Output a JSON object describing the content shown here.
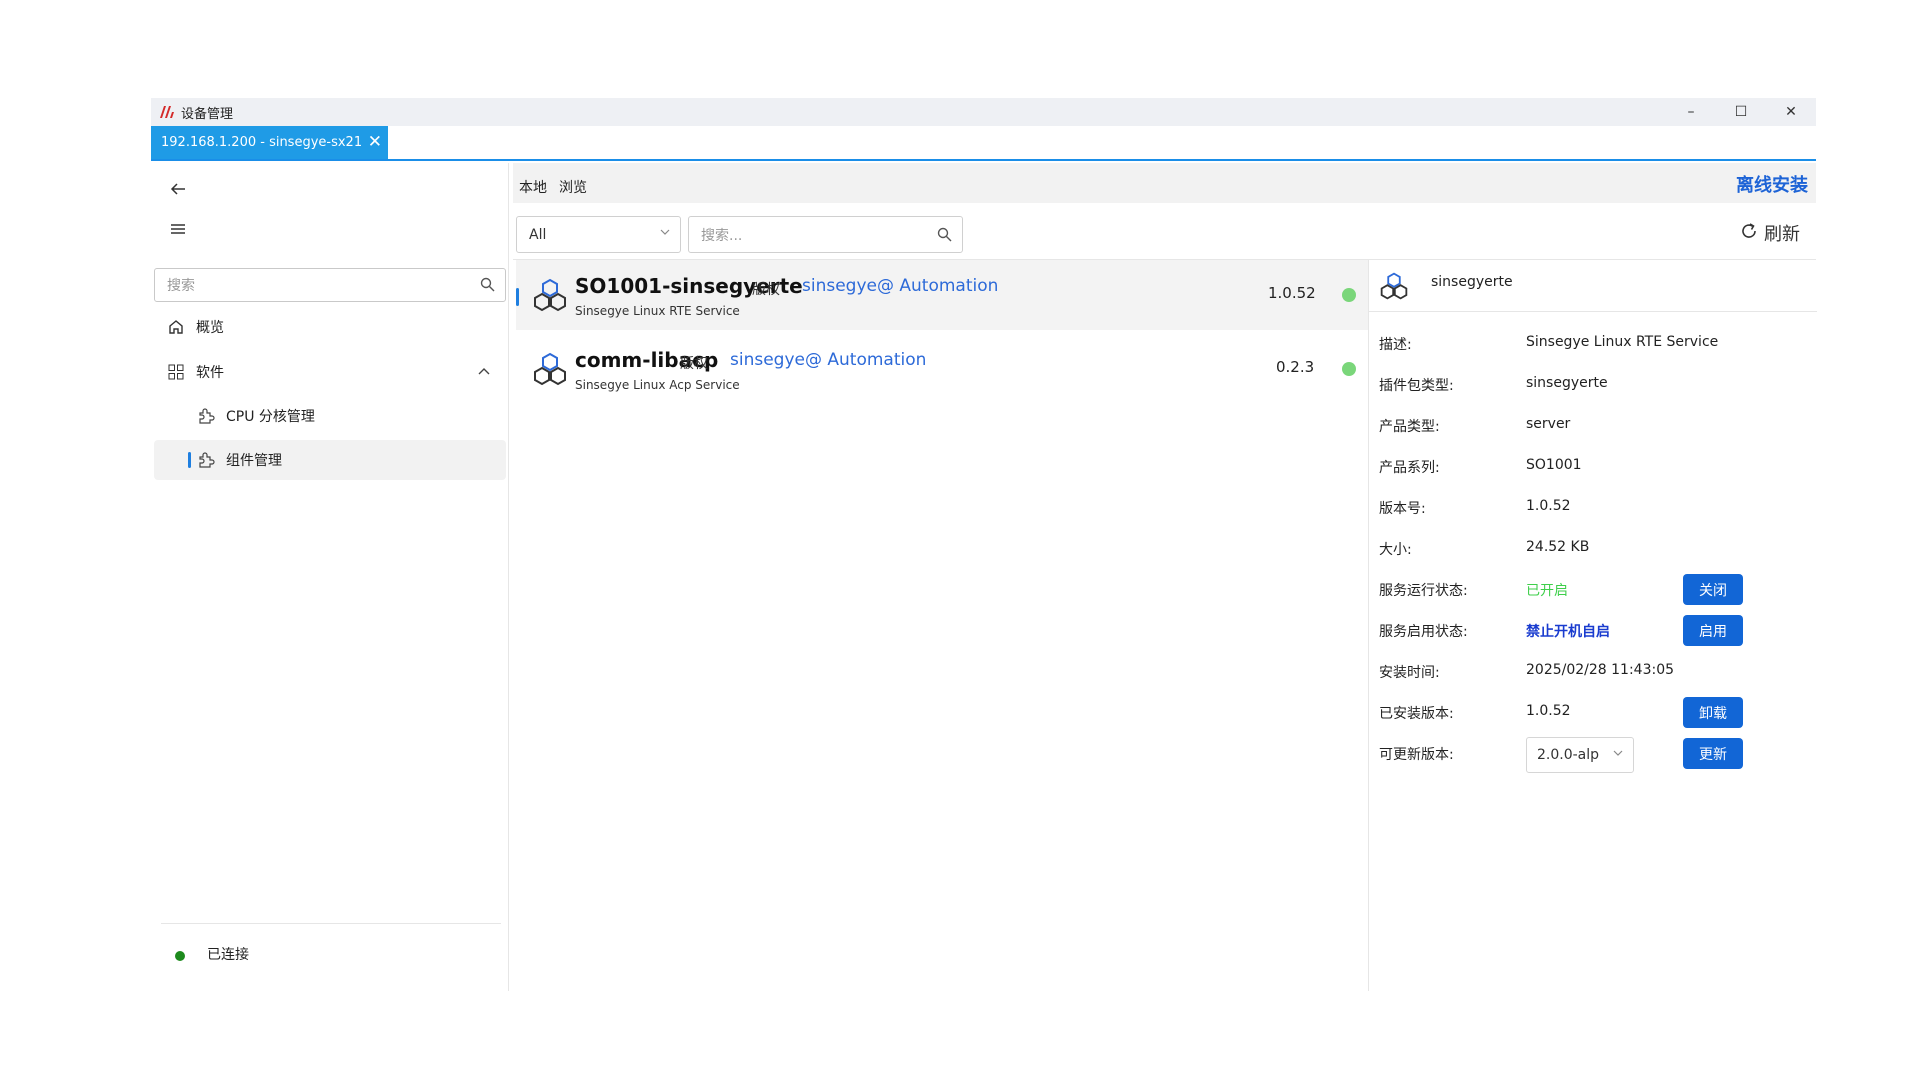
{
  "window": {
    "title": "设备管理",
    "min_label": "–",
    "max_label": "☐",
    "close_label": "✕"
  },
  "connection_tab": {
    "label": "192.168.1.200 - sinsegye-sx21",
    "close_label": "✕"
  },
  "sidebar": {
    "search_placeholder": "搜索",
    "items": [
      {
        "label": "概览",
        "icon": "home-icon"
      },
      {
        "label": "软件",
        "icon": "apps-grid-icon"
      },
      {
        "label": "CPU 分核管理",
        "icon": "puzzle-icon"
      },
      {
        "label": "组件管理",
        "icon": "puzzle-icon"
      }
    ],
    "status": "已连接"
  },
  "main": {
    "tabs": [
      "本地",
      "浏览"
    ],
    "offline_install": "离线安装",
    "filter_value": "All",
    "search_placeholder": "搜索...",
    "refresh_label": "刷新"
  },
  "packages": [
    {
      "name": "SO1001-sinsegyerte",
      "copyright": "版权",
      "author": "sinsegye@ Automation",
      "desc": "Sinsegye Linux RTE Service",
      "version": "1.0.52",
      "status_color": "#7ad67a"
    },
    {
      "name": "comm-libacp",
      "copyright": "版权",
      "author": "sinsegye@ Automation",
      "desc": "Sinsegye Linux Acp Service",
      "version": "0.2.3",
      "status_color": "#7ad67a"
    }
  ],
  "detail": {
    "name": "sinsegyerte",
    "rows": {
      "desc": {
        "k": "描述:",
        "v": "Sinsegye Linux RTE Service"
      },
      "plugin_type": {
        "k": "插件包类型:",
        "v": "sinsegyerte"
      },
      "product_type": {
        "k": "产品类型:",
        "v": "server"
      },
      "product_series": {
        "k": "产品系列:",
        "v": "SO1001"
      },
      "version": {
        "k": "版本号:",
        "v": "1.0.52"
      },
      "size": {
        "k": "大小:",
        "v": "24.52 KB"
      },
      "run_state": {
        "k": "服务运行状态:",
        "v": "已开启",
        "btn": "关闭"
      },
      "enable_state": {
        "k": "服务启用状态:",
        "v": "禁止开机自启",
        "btn": "启用"
      },
      "install_time": {
        "k": "安装时间:",
        "v": "2025/02/28 11:43:05"
      },
      "installed_ver": {
        "k": "已安装版本:",
        "v": "1.0.52",
        "btn": "卸载"
      },
      "update_ver": {
        "k": "可更新版本:",
        "v": "2.0.0-alp",
        "btn": "更新"
      }
    }
  },
  "colors": {
    "accent": "#1f9be6",
    "button": "#1266d6",
    "link": "#2d6ad8",
    "running": "#3fcf4b",
    "connected": "#1d8a1d"
  }
}
